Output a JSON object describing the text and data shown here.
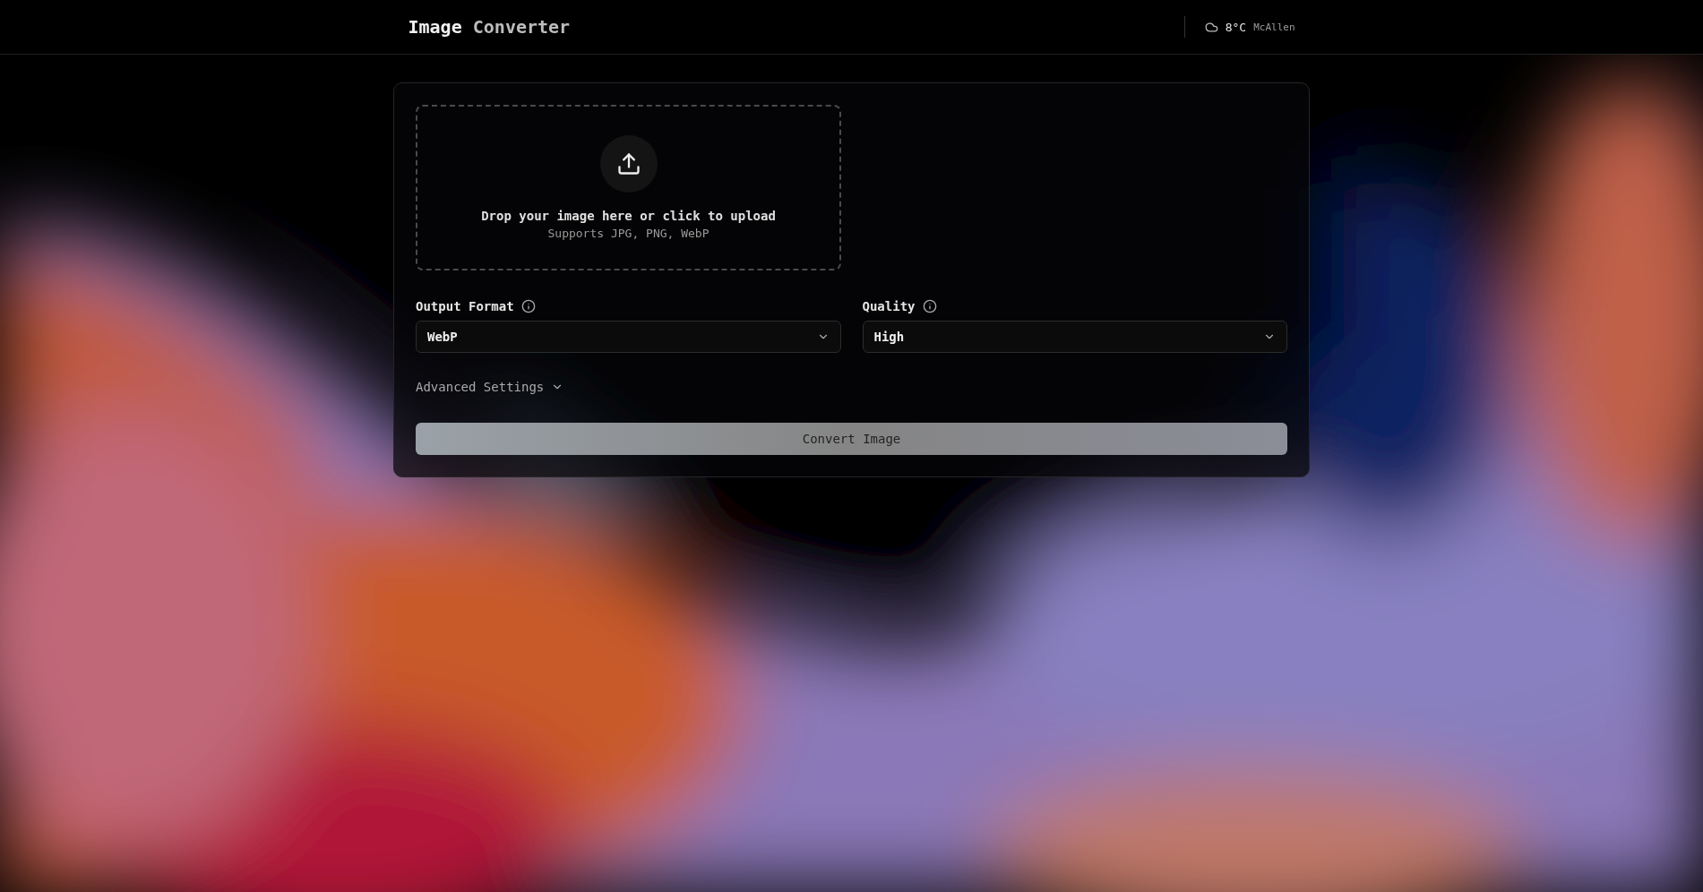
{
  "header": {
    "title": [
      {
        "text": "Image",
        "kind": "strong"
      },
      {
        "text": "Converter",
        "kind": "muted"
      }
    ],
    "weather": {
      "temperature": "8°C",
      "city": "McAllen"
    }
  },
  "upload": {
    "title": "Drop your image here or click to upload",
    "hint": "Supports JPG, PNG, WebP"
  },
  "fields": [
    {
      "label": "Output Format",
      "value": "WebP"
    },
    {
      "label": "Quality",
      "value": "High"
    }
  ],
  "advanced": {
    "label": "Advanced Settings",
    "expanded": false
  },
  "convert_button": "Convert Image"
}
